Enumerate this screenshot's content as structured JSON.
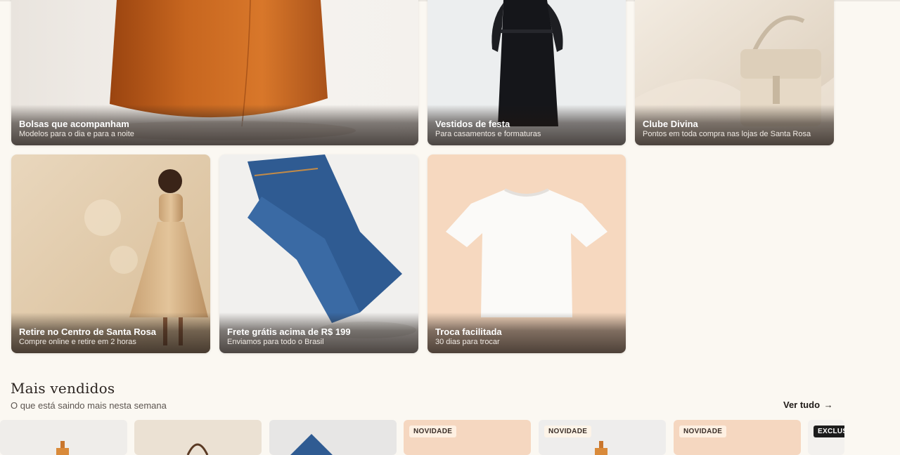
{
  "category_tiles": [
    {
      "title": "Bolsas que acompanham",
      "subtitle": "Modelos para o dia e para a noite",
      "icon": "brown-tote-bag"
    },
    {
      "title": "Vestidos de festa",
      "subtitle": "Para casamentos e formaturas",
      "icon": "black-dress"
    },
    {
      "title": "Clube Divina",
      "subtitle": "Pontos em toda compra nas lojas de Santa Rosa",
      "icon": "cream-handbag"
    },
    {
      "title": "Retire no Centro de Santa Rosa",
      "subtitle": "Compre online e retire em 2 horas",
      "icon": "woman-gold-dress"
    },
    {
      "title": "Frete grátis acima de R$ 199",
      "subtitle": "Enviamos para todo o Brasil",
      "icon": "blue-jeans"
    },
    {
      "title": "Troca facilitada",
      "subtitle": "30 dias para trocar",
      "icon": "white-tshirt"
    }
  ],
  "best_sellers": {
    "title": "Mais vendidos",
    "subtitle": "O que está saindo mais nesta semana",
    "see_all_label": "Ver tudo",
    "see_all_icon": "arrow-right-icon",
    "products": [
      {
        "badge": ""
      },
      {
        "badge": ""
      },
      {
        "badge": ""
      },
      {
        "badge": "NOVIDADE"
      },
      {
        "badge": "NOVIDADE"
      },
      {
        "badge": "NOVIDADE"
      },
      {
        "badge": "EXCLUS"
      }
    ]
  },
  "colors": {
    "page_background": "#fbf8f2",
    "text_primary": "#2b2420",
    "badge_dark": "#1c1c1c"
  }
}
